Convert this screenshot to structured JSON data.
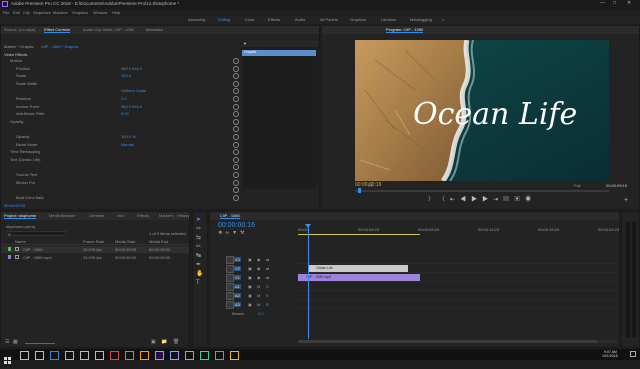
{
  "window": {
    "title": "Adobe Premiere Pro CC 2018 - E:\\Documents\\Adobe\\Premiere Pro\\12.0\\stophome *",
    "controls": [
      "minimize",
      "maximize",
      "close"
    ]
  },
  "menu": [
    "File",
    "Edit",
    "Clip",
    "Sequence",
    "Markers",
    "Graphics",
    "Window",
    "Help"
  ],
  "workspaces": [
    "Assembly",
    "Editing",
    "Color",
    "Effects",
    "Audio",
    "All Panels",
    "Graphics",
    "Libraries",
    "Metalogging"
  ],
  "active_workspace": "Editing",
  "source_tabs": [
    "Source: (no clips)",
    "Effect Controls",
    "Audio Clip Mixer: CliP - 1080",
    "Metadata"
  ],
  "effect_controls": {
    "master_label": "Master * Graphic",
    "clip_label": "CliP - 1080 * Graphic",
    "video_effects_label": "Video Effects",
    "properties": [
      {
        "name": "Motion",
        "value": "",
        "indent": 1
      },
      {
        "name": "Position",
        "value": "960.0   540.0",
        "indent": 2
      },
      {
        "name": "Scale",
        "value": "100.0",
        "indent": 2
      },
      {
        "name": "Scale Width",
        "value": "",
        "indent": 2
      },
      {
        "name": "",
        "value": "Uniform Scale",
        "indent": 3
      },
      {
        "name": "Rotation",
        "value": "0.0",
        "indent": 2
      },
      {
        "name": "Anchor Point",
        "value": "960.0   540.0",
        "indent": 2
      },
      {
        "name": "Anti-flicker Filter",
        "value": "0.00",
        "indent": 2
      },
      {
        "name": "Opacity",
        "value": "",
        "indent": 1
      },
      {
        "name": "",
        "value": "",
        "indent": 2
      },
      {
        "name": "Opacity",
        "value": "100.0 %",
        "indent": 2
      },
      {
        "name": "Blend Mode",
        "value": "Normal",
        "indent": 2
      },
      {
        "name": "Time Remapping",
        "value": "",
        "indent": 1
      },
      {
        "name": "Text (Ocean Life)",
        "value": "",
        "indent": 1
      },
      {
        "name": "",
        "value": "",
        "indent": 2
      },
      {
        "name": "Source Text",
        "value": "",
        "indent": 2
      },
      {
        "name": "Minion Pro",
        "value": "",
        "indent": 2
      },
      {
        "name": "",
        "value": "",
        "indent": 2
      },
      {
        "name": "Bold Cond Italic",
        "value": "",
        "indent": 2
      }
    ],
    "mini_clip_label": "Graphic",
    "timecode": "00:00:00:00"
  },
  "program": {
    "title": "Program: CliP - 1080",
    "overlay_text": "Ocean Life",
    "timecode_left": "00:00:00:16",
    "fit": "Fit",
    "quality": "Full",
    "timecode_right": "00:00:09:16"
  },
  "project": {
    "tabs": [
      "Project: stophome",
      "Media Browser",
      "Libraries",
      "Info",
      "Effects",
      "Markers",
      "History"
    ],
    "filename": "stophome.prproj",
    "items_selected": "1 of 3 items selected",
    "columns": [
      "Name",
      "Frame Rate",
      "Media Start",
      "Media End"
    ],
    "rows": [
      {
        "name": "CliP - 1080",
        "fps": "23.976 fps",
        "start": "00:00:00:00",
        "end": "00:00:25:03",
        "color": "#57b857"
      },
      {
        "name": "CliP - 1080.mp4",
        "fps": "23.976 fps",
        "start": "00:00:00:00",
        "end": "00:00:25:03",
        "color": "#8f7fcf"
      }
    ]
  },
  "timeline": {
    "title": "CliP - 1080",
    "timecode": "00:00:00:16",
    "ruler": [
      "00:00",
      "00:00:04:23",
      "00:00:09:23",
      "00:00:14:23",
      "00:00:19:23",
      "00:00:24:23"
    ],
    "tracks": [
      "V3",
      "V2",
      "V1",
      "A1",
      "A2",
      "A3"
    ],
    "master_label": "Master",
    "master_value": "0.0",
    "clips": [
      {
        "label": "Ocean Life",
        "track": "V2",
        "color": "#c9c9c9"
      },
      {
        "label": "CliP - 1080.mp4",
        "track": "V1",
        "color": "#9b84d9"
      }
    ]
  },
  "taskbar": {
    "time": "9:07 AM",
    "date": "10/1/2018"
  },
  "colors": {
    "accent": "#2d8ceb",
    "graphic_clip": "#c9c9c9",
    "video_clip": "#9b84d9"
  }
}
